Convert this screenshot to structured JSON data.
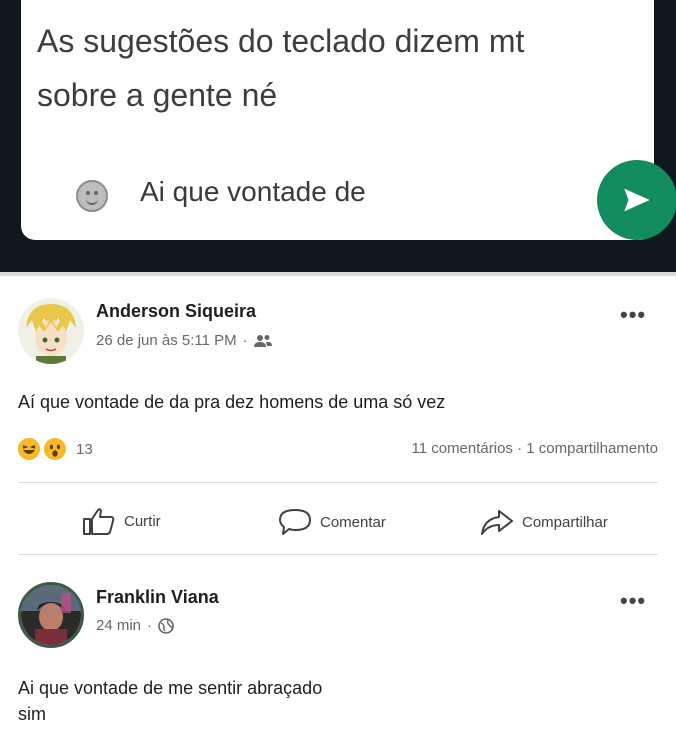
{
  "message": {
    "text": "As sugestões do teclado dizem mt\nsobre a gente né",
    "input_text": "Ai que vontade de"
  },
  "posts": [
    {
      "author": "Anderson Siqueira",
      "time": "26 de jun às 5:11 PM",
      "text": "Aí que vontade de da pra dez homens de uma só vez",
      "reaction_count": "13",
      "stats": "11 comentários · 1 compartilhamento"
    },
    {
      "author": "Franklin Viana",
      "time": "24 min",
      "text": "Ai que vontade de me sentir abraçado\nsim"
    }
  ],
  "actions": {
    "like": "Curtir",
    "comment": "Comentar",
    "share": "Compartilhar"
  },
  "colors": {
    "send_button": "#128c5e",
    "dark_background": "#0f1720"
  }
}
